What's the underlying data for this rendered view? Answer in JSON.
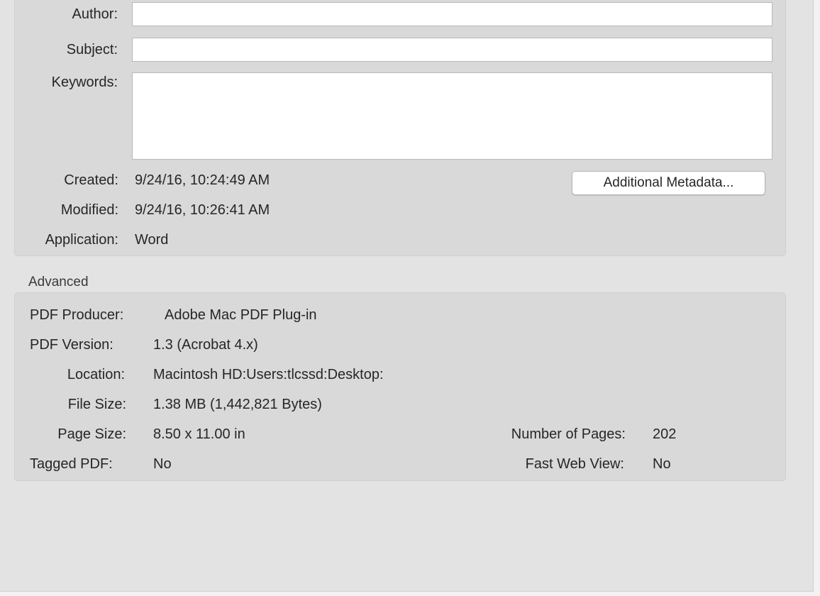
{
  "description": {
    "author_label": "Author:",
    "author_value": "",
    "subject_label": "Subject:",
    "subject_value": "",
    "keywords_label": "Keywords:",
    "keywords_value": "",
    "created_label": "Created:",
    "created_value": "9/24/16, 10:24:49 AM",
    "modified_label": "Modified:",
    "modified_value": "9/24/16, 10:26:41 AM",
    "application_label": "Application:",
    "application_value": "Word",
    "metadata_button": "Additional Metadata..."
  },
  "advanced": {
    "title": "Advanced",
    "producer_label": "PDF Producer:",
    "producer_value": "Adobe Mac PDF Plug-in",
    "version_label": "PDF Version:",
    "version_value": "1.3 (Acrobat 4.x)",
    "location_label": "Location:",
    "location_value": "Macintosh HD:Users:tlcssd:Desktop:",
    "filesize_label": "File Size:",
    "filesize_value": "1.38 MB (1,442,821 Bytes)",
    "pagesize_label": "Page Size:",
    "pagesize_value": "8.50 x 11.00 in",
    "numpages_label": "Number of Pages:",
    "numpages_value": "202",
    "tagged_label": "Tagged PDF:",
    "tagged_value": "No",
    "fastweb_label": "Fast Web View:",
    "fastweb_value": "No"
  }
}
